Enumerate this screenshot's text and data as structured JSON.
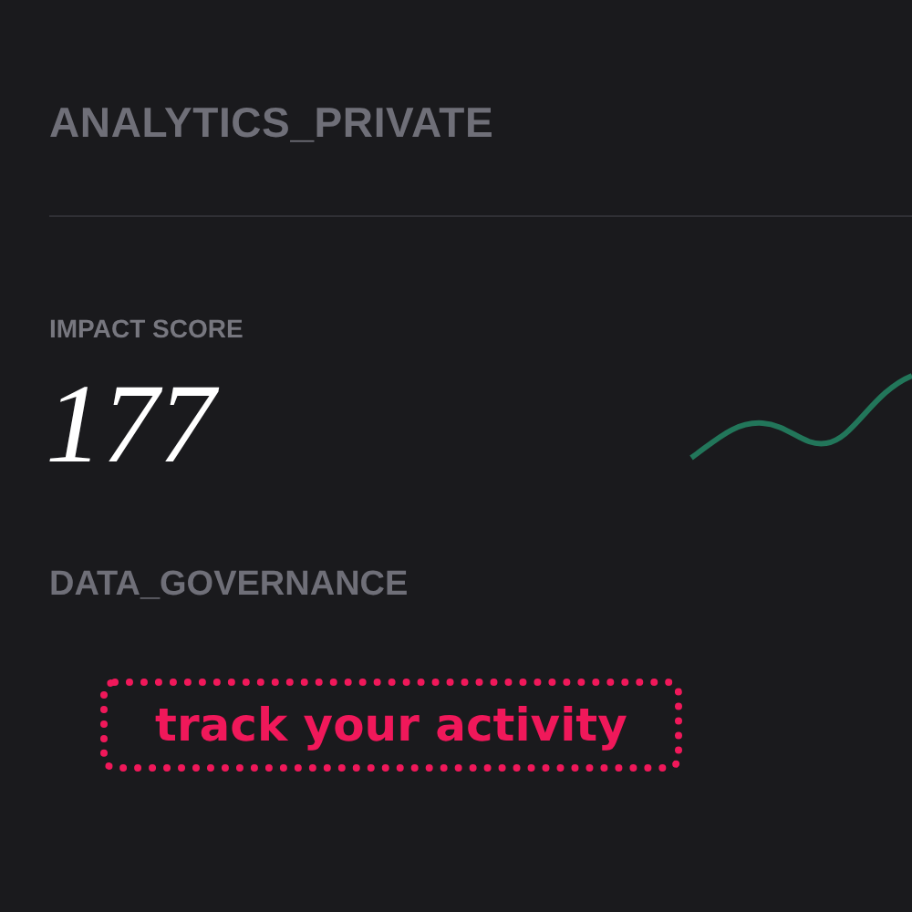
{
  "header": {
    "title": "ANALYTICS_PRIVATE"
  },
  "metric": {
    "label": "IMPACT SCORE",
    "value": "177"
  },
  "section": {
    "title": "DATA_GOVERNANCE"
  },
  "callout": {
    "text": "track your activity"
  }
}
